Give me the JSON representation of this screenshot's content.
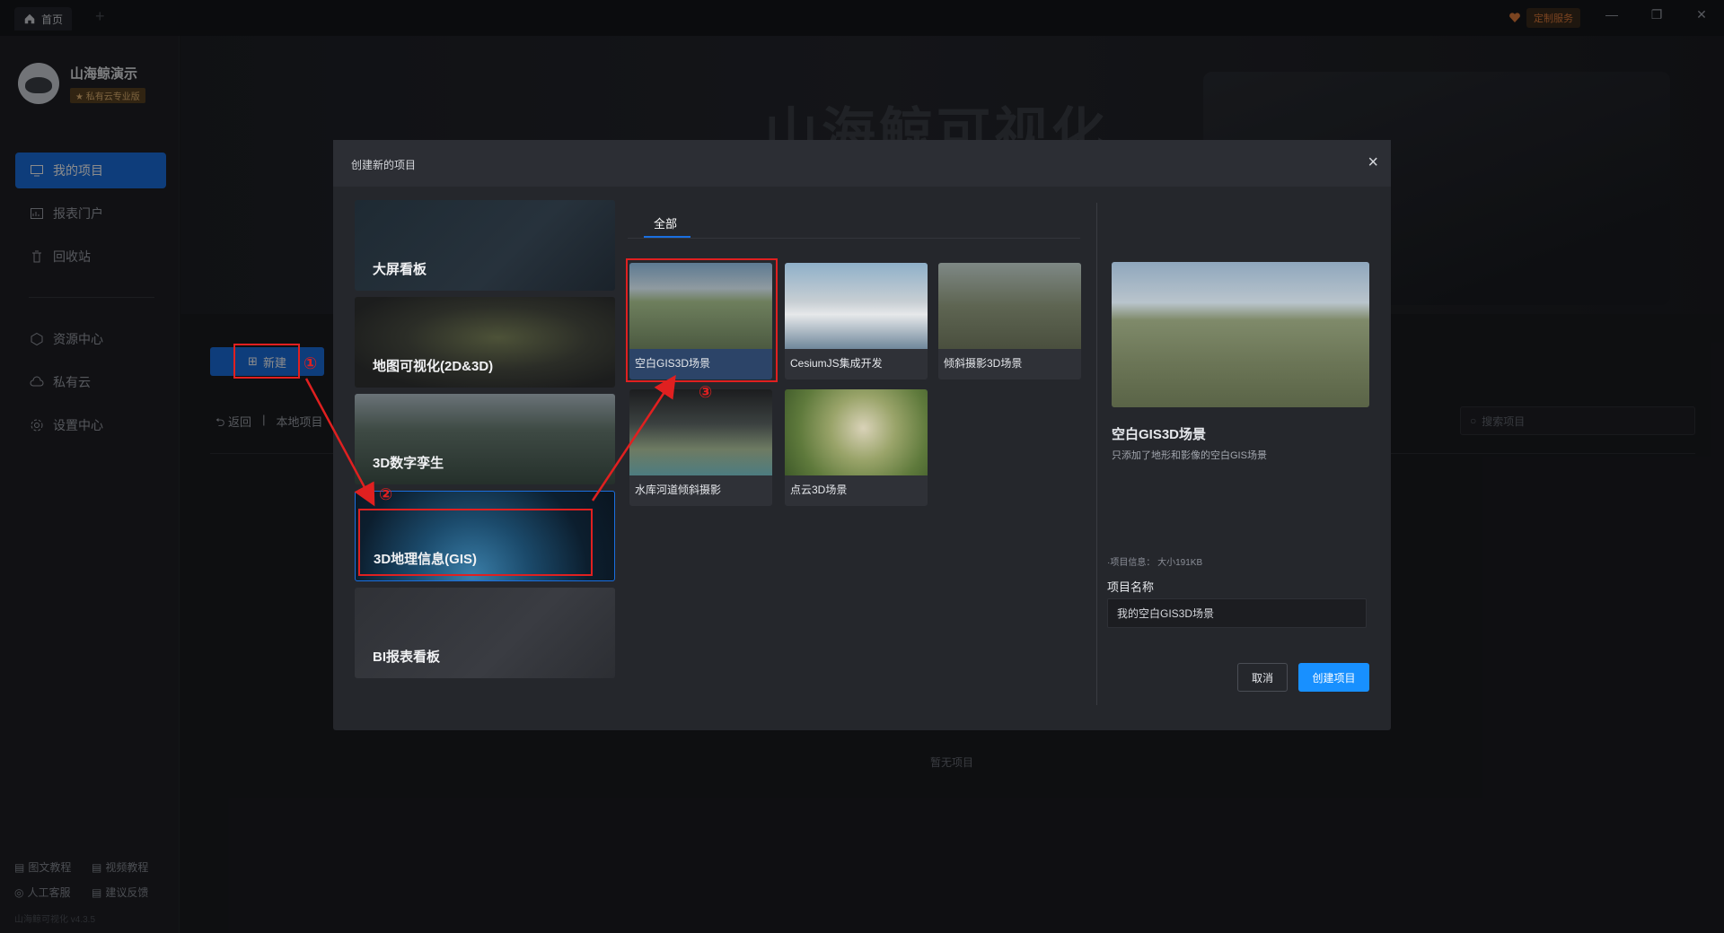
{
  "topbar": {
    "home_tab": "首页",
    "new_tab": "+",
    "service": "定制服务",
    "minimize": "—",
    "restore": "❐",
    "close": "✕"
  },
  "sidebar": {
    "brand_name": "山海鲸演示",
    "brand_tag": "★ 私有云专业版",
    "items": [
      {
        "label": "我的项目",
        "icon": "monitor-icon",
        "active": true
      },
      {
        "label": "报表门户",
        "icon": "report-icon"
      },
      {
        "label": "回收站",
        "icon": "trash-icon"
      },
      {
        "label": "资源中心",
        "icon": "resource-icon"
      },
      {
        "label": "私有云",
        "icon": "cloud-icon"
      },
      {
        "label": "设置中心",
        "icon": "gear-icon"
      }
    ],
    "footer": {
      "doc_tutorial": "图文教程",
      "video_tutorial": "视频教程",
      "manual_service": "人工客服",
      "feedback": "建议反馈"
    },
    "version": "山海鲸可视化 v4.3.5"
  },
  "main": {
    "banner_title": "山海鲸可视化",
    "new_button": "新建",
    "back": "返回",
    "breadcrumb": "本地项目",
    "search_placeholder": "搜索项目",
    "empty": "暂无项目"
  },
  "modal": {
    "title": "创建新的项目",
    "close": "×",
    "categories": [
      "大屏看板",
      "地图可视化(2D&3D)",
      "3D数字孪生",
      "3D地理信息(GIS)",
      "BI报表看板"
    ],
    "selected_category": "3D地理信息(GIS)",
    "tab": "全部",
    "templates": [
      "空白GIS3D场景",
      "CesiumJS集成开发",
      "倾斜摄影3D场景",
      "水库河道倾斜摄影",
      "点云3D场景"
    ],
    "selected_template": "空白GIS3D场景",
    "preview": {
      "title": "空白GIS3D场景",
      "desc": "只添加了地形和影像的空白GIS场景",
      "info": "·项目信息： 大小191KB",
      "name_label": "项目名称",
      "name_value": "我的空白GIS3D场景"
    },
    "cancel": "取消",
    "create": "创建项目"
  },
  "annotations": {
    "step1": "①",
    "step2": "②",
    "step3": "③",
    "color": "#e02020"
  },
  "colors": {
    "accent": "#1a6fe0",
    "primary_button": "#1890ff"
  }
}
